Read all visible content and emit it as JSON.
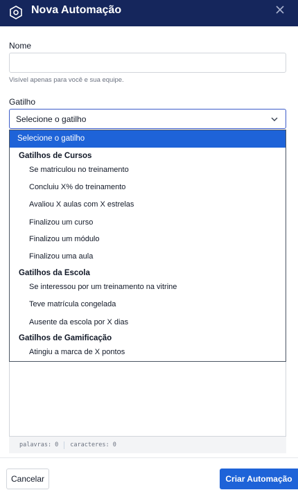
{
  "header": {
    "title": "Nova Automação",
    "bg_color": "#15265c",
    "icon": "hexagon-gear-icon",
    "close_icon": "close-icon"
  },
  "form": {
    "name_label": "Nome",
    "name_value": "",
    "name_hint": "Visível apenas para você e sua equipe.",
    "trigger_label": "Gatilho",
    "trigger_selected": "Selecione o gatilho"
  },
  "dropdown": {
    "placeholder": "Selecione o gatilho",
    "groups": [
      {
        "label": "Gatilhos de Cursos",
        "options": [
          "Se matriculou no treinamento",
          "Concluiu X% do treinamento",
          "Avaliou X aulas com X estrelas",
          "Finalizou um curso",
          "Finalizou um módulo",
          "Finalizou uma aula"
        ]
      },
      {
        "label": "Gatilhos da Escola",
        "options": [
          "Se interessou por um treinamento na vitrine",
          "Teve matrícula congelada",
          "Ausente da escola por X dias"
        ]
      },
      {
        "label": "Gatilhos de Gamificação",
        "options": [
          "Atingiu a marca de X pontos"
        ]
      }
    ]
  },
  "counter": {
    "words": "palavras: 0",
    "chars": "caracteres: 0"
  },
  "footer": {
    "cancel_label": "Cancelar",
    "create_label": "Criar Automação"
  },
  "colors": {
    "accent": "#1e63d8"
  }
}
